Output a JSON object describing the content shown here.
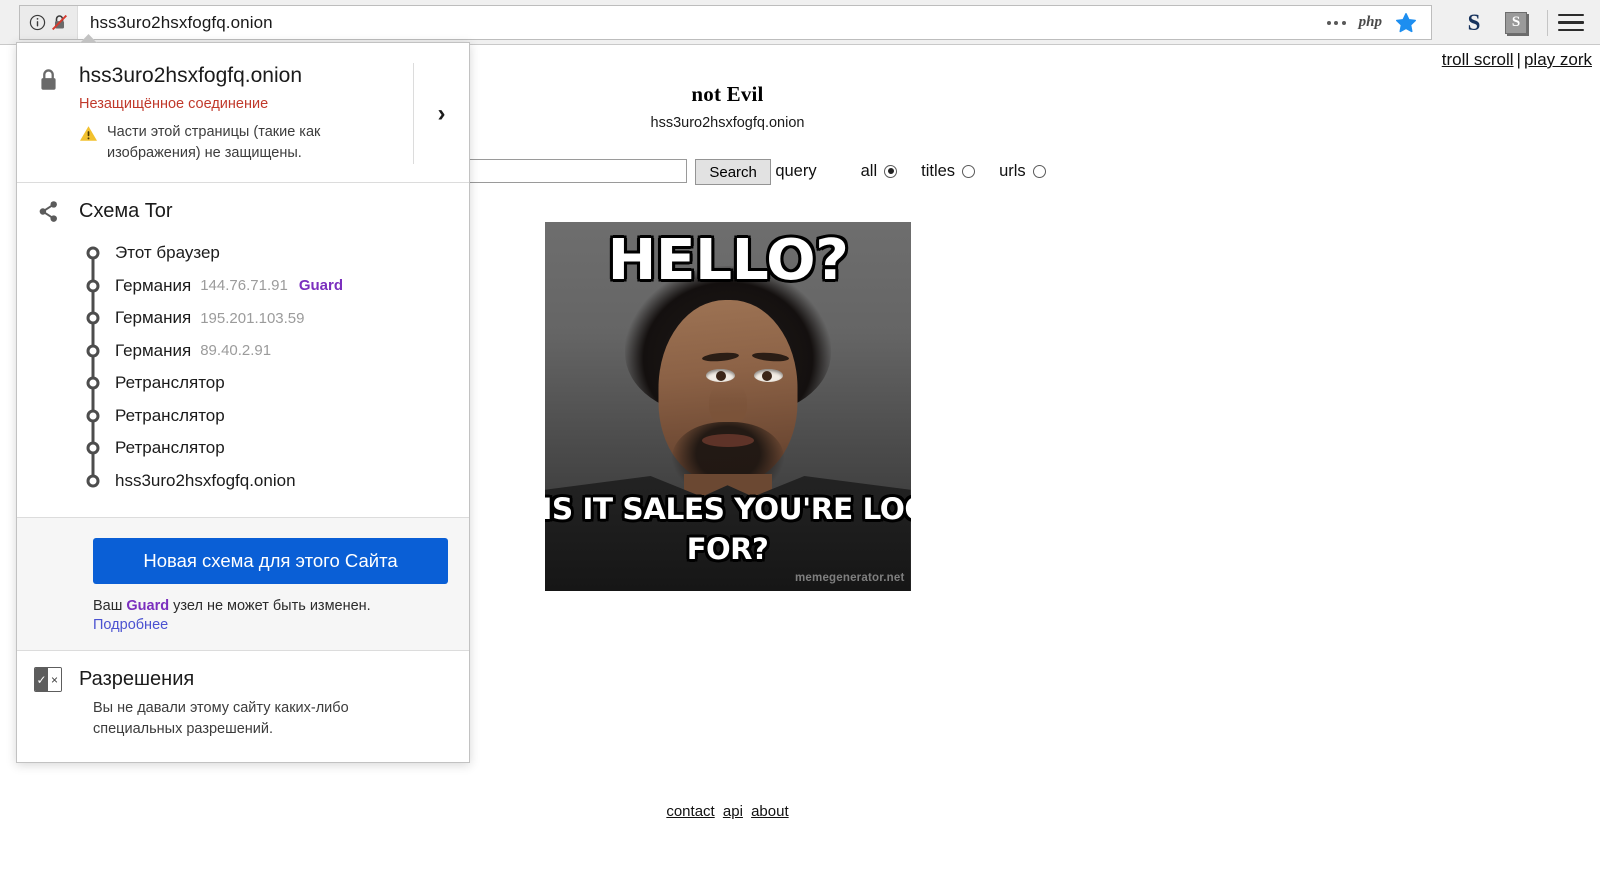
{
  "browser": {
    "url": "hss3uro2hsxfogfq.onion",
    "icons": {
      "info": "info-icon",
      "broken_lock": "broken-lock-icon",
      "page_actions": "ellipsis-icon",
      "php_badge": "php",
      "bookmark": "star-icon",
      "extension_s": "S",
      "extension_s2": "S",
      "menu": "hamburger-icon"
    }
  },
  "popup": {
    "identity": {
      "host": "hss3uro2hsxfogfq.onion",
      "connection_status": "Незащищённое соединение",
      "mixed_content_warning": "Части этой страницы (такие как изображения) не защищены.",
      "expand_chevron": "›"
    },
    "circuit": {
      "title": "Схема Tor",
      "nodes": [
        {
          "label": "Этот браузер",
          "ip": "",
          "role": ""
        },
        {
          "label": "Германия",
          "ip": "144.76.71.91",
          "role": "Guard"
        },
        {
          "label": "Германия",
          "ip": "195.201.103.59",
          "role": ""
        },
        {
          "label": "Германия",
          "ip": "89.40.2.91",
          "role": ""
        },
        {
          "label": "Ретранслятор",
          "ip": "",
          "role": ""
        },
        {
          "label": "Ретранслятор",
          "ip": "",
          "role": ""
        },
        {
          "label": "Ретранслятор",
          "ip": "",
          "role": ""
        },
        {
          "label": "hss3uro2hsxfogfq.onion",
          "ip": "",
          "role": ""
        }
      ]
    },
    "new_circuit": {
      "button_label": "Новая схема для этого Сайта",
      "note_before": "Ваш ",
      "note_guard": "Guard",
      "note_after": " узел не может быть изменен.",
      "more_link": "Подробнее"
    },
    "permissions": {
      "title": "Разрешения",
      "body": "Вы не давали этому сайту каких-либо специальных разрешений.",
      "icon_check": "✓",
      "icon_cross": "×"
    }
  },
  "page": {
    "top_links": [
      {
        "label": "troll scroll"
      },
      {
        "label": "play zork"
      }
    ],
    "top_links_separator": "|",
    "title": "not Evil",
    "host": "hss3uro2hsxfogfq.onion",
    "search": {
      "value": "",
      "placeholder": "",
      "button_label": "Search",
      "query_label": "query",
      "options": [
        {
          "label": "all",
          "selected": true
        },
        {
          "label": "titles",
          "selected": false
        },
        {
          "label": "urls",
          "selected": false
        }
      ]
    },
    "meme": {
      "top_text": "HELLO?",
      "bottom_text_line1": "IS IT SALES YOU'RE LOOKING",
      "bottom_text_line2": "FOR?",
      "watermark": "memegenerator.net"
    },
    "footer_links": [
      {
        "label": "contact"
      },
      {
        "label": "api"
      },
      {
        "label": "about"
      }
    ]
  },
  "colors": {
    "accent_blue": "#0a5fd6",
    "guard_purple": "#7b2fbe",
    "insecure_red": "#c0392b",
    "link_blue": "#4b52d1",
    "warn_yellow": "#f2c12e"
  }
}
